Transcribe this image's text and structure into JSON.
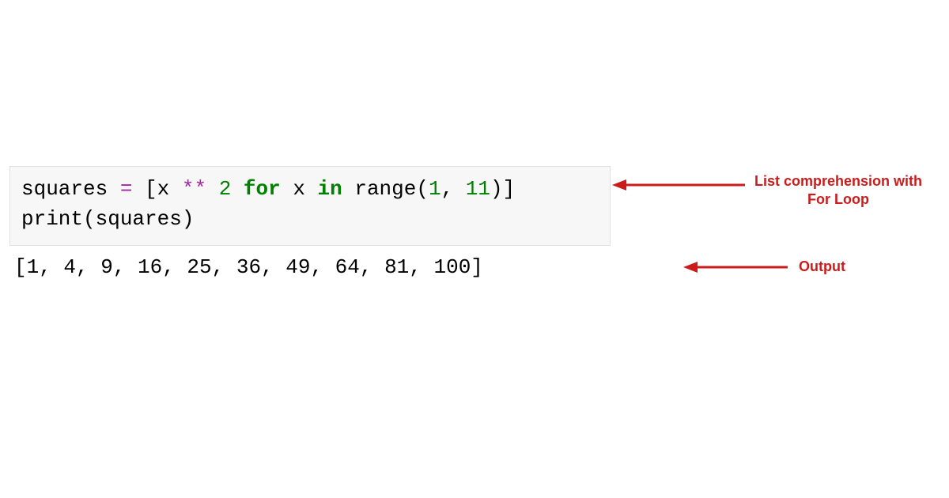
{
  "code": {
    "line1": {
      "t1": "squares ",
      "t2": "=",
      "t3": " [x ",
      "t4": "**",
      "t5": " ",
      "t6": "2",
      "t7": " ",
      "t8": "for",
      "t9": " x ",
      "t10": "in",
      "t11": " range(",
      "t12": "1",
      "t13": ", ",
      "t14": "11",
      "t15": ")]"
    },
    "line2": "print(squares)"
  },
  "output": "[1, 4, 9, 16, 25, 36, 49, 64, 81, 100]",
  "annotations": {
    "top": "List comprehension with For Loop",
    "bottom": "Output"
  },
  "colors": {
    "annotation": "#cc1b1b",
    "keyword": "#008000",
    "operator": "#a626a4",
    "cellBg": "#f7f7f7"
  }
}
